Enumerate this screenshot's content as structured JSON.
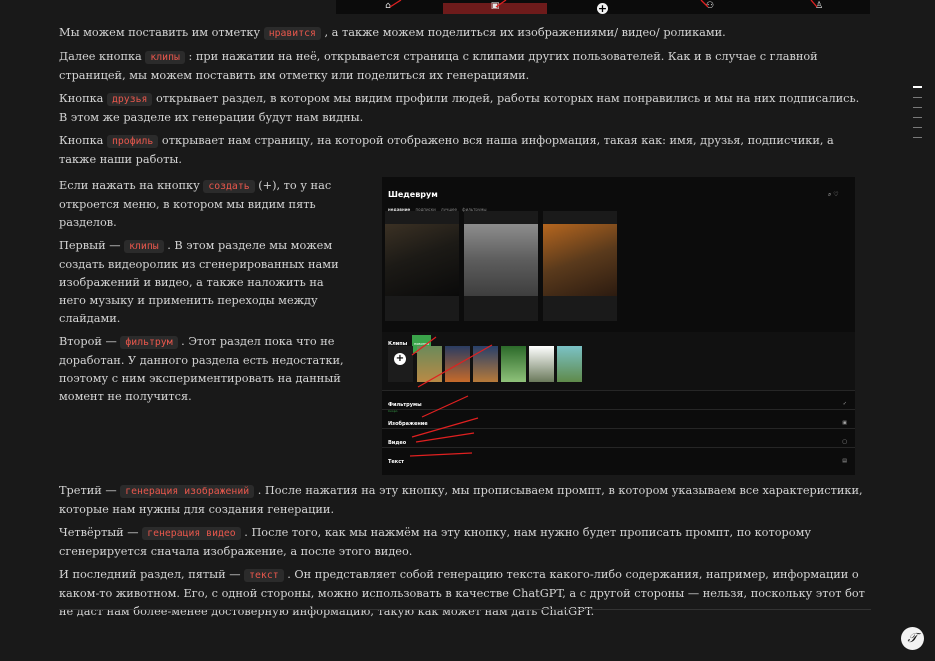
{
  "topbar": {
    "plus_label": "+"
  },
  "paragraphs": {
    "p1": {
      "before": "Мы можем поставить им отметку ",
      "code": "нравится",
      "after": " , а также можем поделиться их изображениями/ видео/ роликами."
    },
    "p2": {
      "before": "Далее кнопка ",
      "code": "клипы",
      "after": " : при нажатии на неё, открывается страница с клипами других пользователей. Как и в случае с главной страницей, мы можем поставить им отметку или поделиться их генерациями."
    },
    "p3": {
      "before": "Кнопка ",
      "code": "друзья",
      "after": " открывает раздел, в котором мы видим профили людей, работы которых нам понравились и мы на них подписались. В этом же разделе их генерации будут нам видны."
    },
    "p4": {
      "before": "Кнопка ",
      "code": "профиль",
      "after": " открывает нам страницу, на которой отображено вся наша информация, такая как: имя, друзья, подписчики, а также наши работы."
    },
    "p5": {
      "before": "Если нажать на кнопку ",
      "code": "создать",
      "after": " (+), то у нас откроется меню, в котором мы видим пять разделов."
    },
    "p6": {
      "before": "Первый — ",
      "code": "клипы",
      "after": " . В этом разделе мы можем создать видеоролик из сгенерированных нами изображений и видео, а также наложить на него музыку и применить переходы между слайдами."
    },
    "p7": {
      "before": "Второй — ",
      "code": "фильтрум",
      "after": " . Этот раздел пока что не доработан. У данного раздела есть недостатки, поэтому с ним экспериментировать на данный момент не получится."
    },
    "p8": {
      "before": " Третий — ",
      "code": "генерация изображений",
      "after": " . После нажатия на эту кнопку, мы прописываем промпт, в котором указываем все характеристики, которые нам нужны для создания генерации."
    },
    "p9": {
      "before": "Четвёртый — ",
      "code": "генерация видео",
      "after": " . После того, как мы нажмём на эту кнопку, нам нужно будет прописать промпт, по которому сгенерируется сначала изображение, а после этого видео."
    },
    "p10": {
      "before": "И последний раздел, пятый — ",
      "code": "текст",
      "after": " . Он представляет собой генерацию текста какого-либо содержания, например, информации о каком-то животном. Его, с одной стороны, можно использовать в качестве ChatGPT, а с другой стороны — нельзя, поскольку этот бот не даст нам более-менее достоверную информацию, такую как может нам дать ChatGPT."
    }
  },
  "screenshot": {
    "brand": "Шедеврум",
    "tab_active": "недавние",
    "tabs_rest": "подписки лучшее фильтрумы",
    "clips_label": "Клипы",
    "clips_badge": "новинка",
    "add_label": "+",
    "rows": {
      "filtrum": "Фильтрумы",
      "filtrum_sub": "Скоро",
      "image": "Изображение",
      "video": "Видео",
      "text": "Текст"
    }
  },
  "fab_label": "𝒯"
}
